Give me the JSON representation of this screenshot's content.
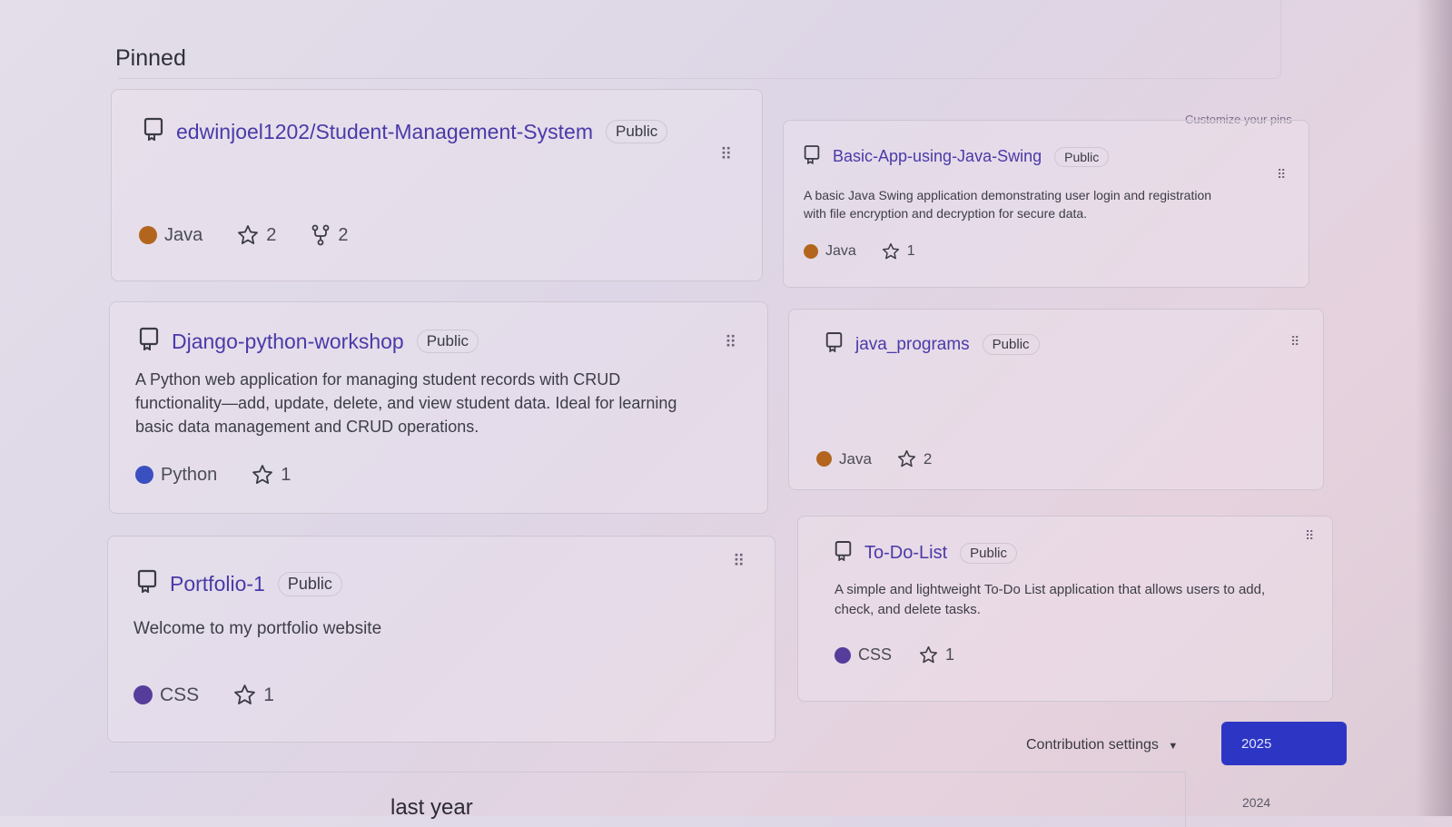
{
  "section_title": "Pinned",
  "customize_label": "Customize your pins",
  "badge_label": "Public",
  "colors": {
    "java": "#b3651e",
    "python": "#3a4fc0",
    "css": "#563d9c",
    "accent": "#2d36c4",
    "link": "#4a3aa8"
  },
  "cards": [
    {
      "name": "edwinjoel1202/Student-Management-System",
      "description": "",
      "language": "Java",
      "stars": "2",
      "forks": "2"
    },
    {
      "name": "Basic-App-using-Java-Swing",
      "description_lines": [
        "A basic Java Swing application demonstrating user login and registration",
        "with file encryption and decryption for secure data."
      ],
      "language": "Java",
      "stars": "1"
    },
    {
      "name": "Django-python-workshop",
      "description_lines": [
        "A Python web application for managing student records with CRUD",
        "functionality—add, update, delete, and view student data. Ideal for learning",
        "basic data management and CRUD operations."
      ],
      "language": "Python",
      "stars": "1"
    },
    {
      "name": "java_programs",
      "description": "",
      "language": "Java",
      "stars": "2"
    },
    {
      "name": "Portfolio-1",
      "description": "Welcome to my portfolio website",
      "language": "CSS",
      "stars": "1"
    },
    {
      "name": "To-Do-List",
      "description_lines": [
        "A simple and lightweight To-Do List application that allows users to add,",
        "check, and delete tasks."
      ],
      "language": "CSS",
      "stars": "1"
    }
  ],
  "contribution_settings": "Contribution settings",
  "years": [
    "2025",
    "2024"
  ],
  "partial_heading": "last year"
}
